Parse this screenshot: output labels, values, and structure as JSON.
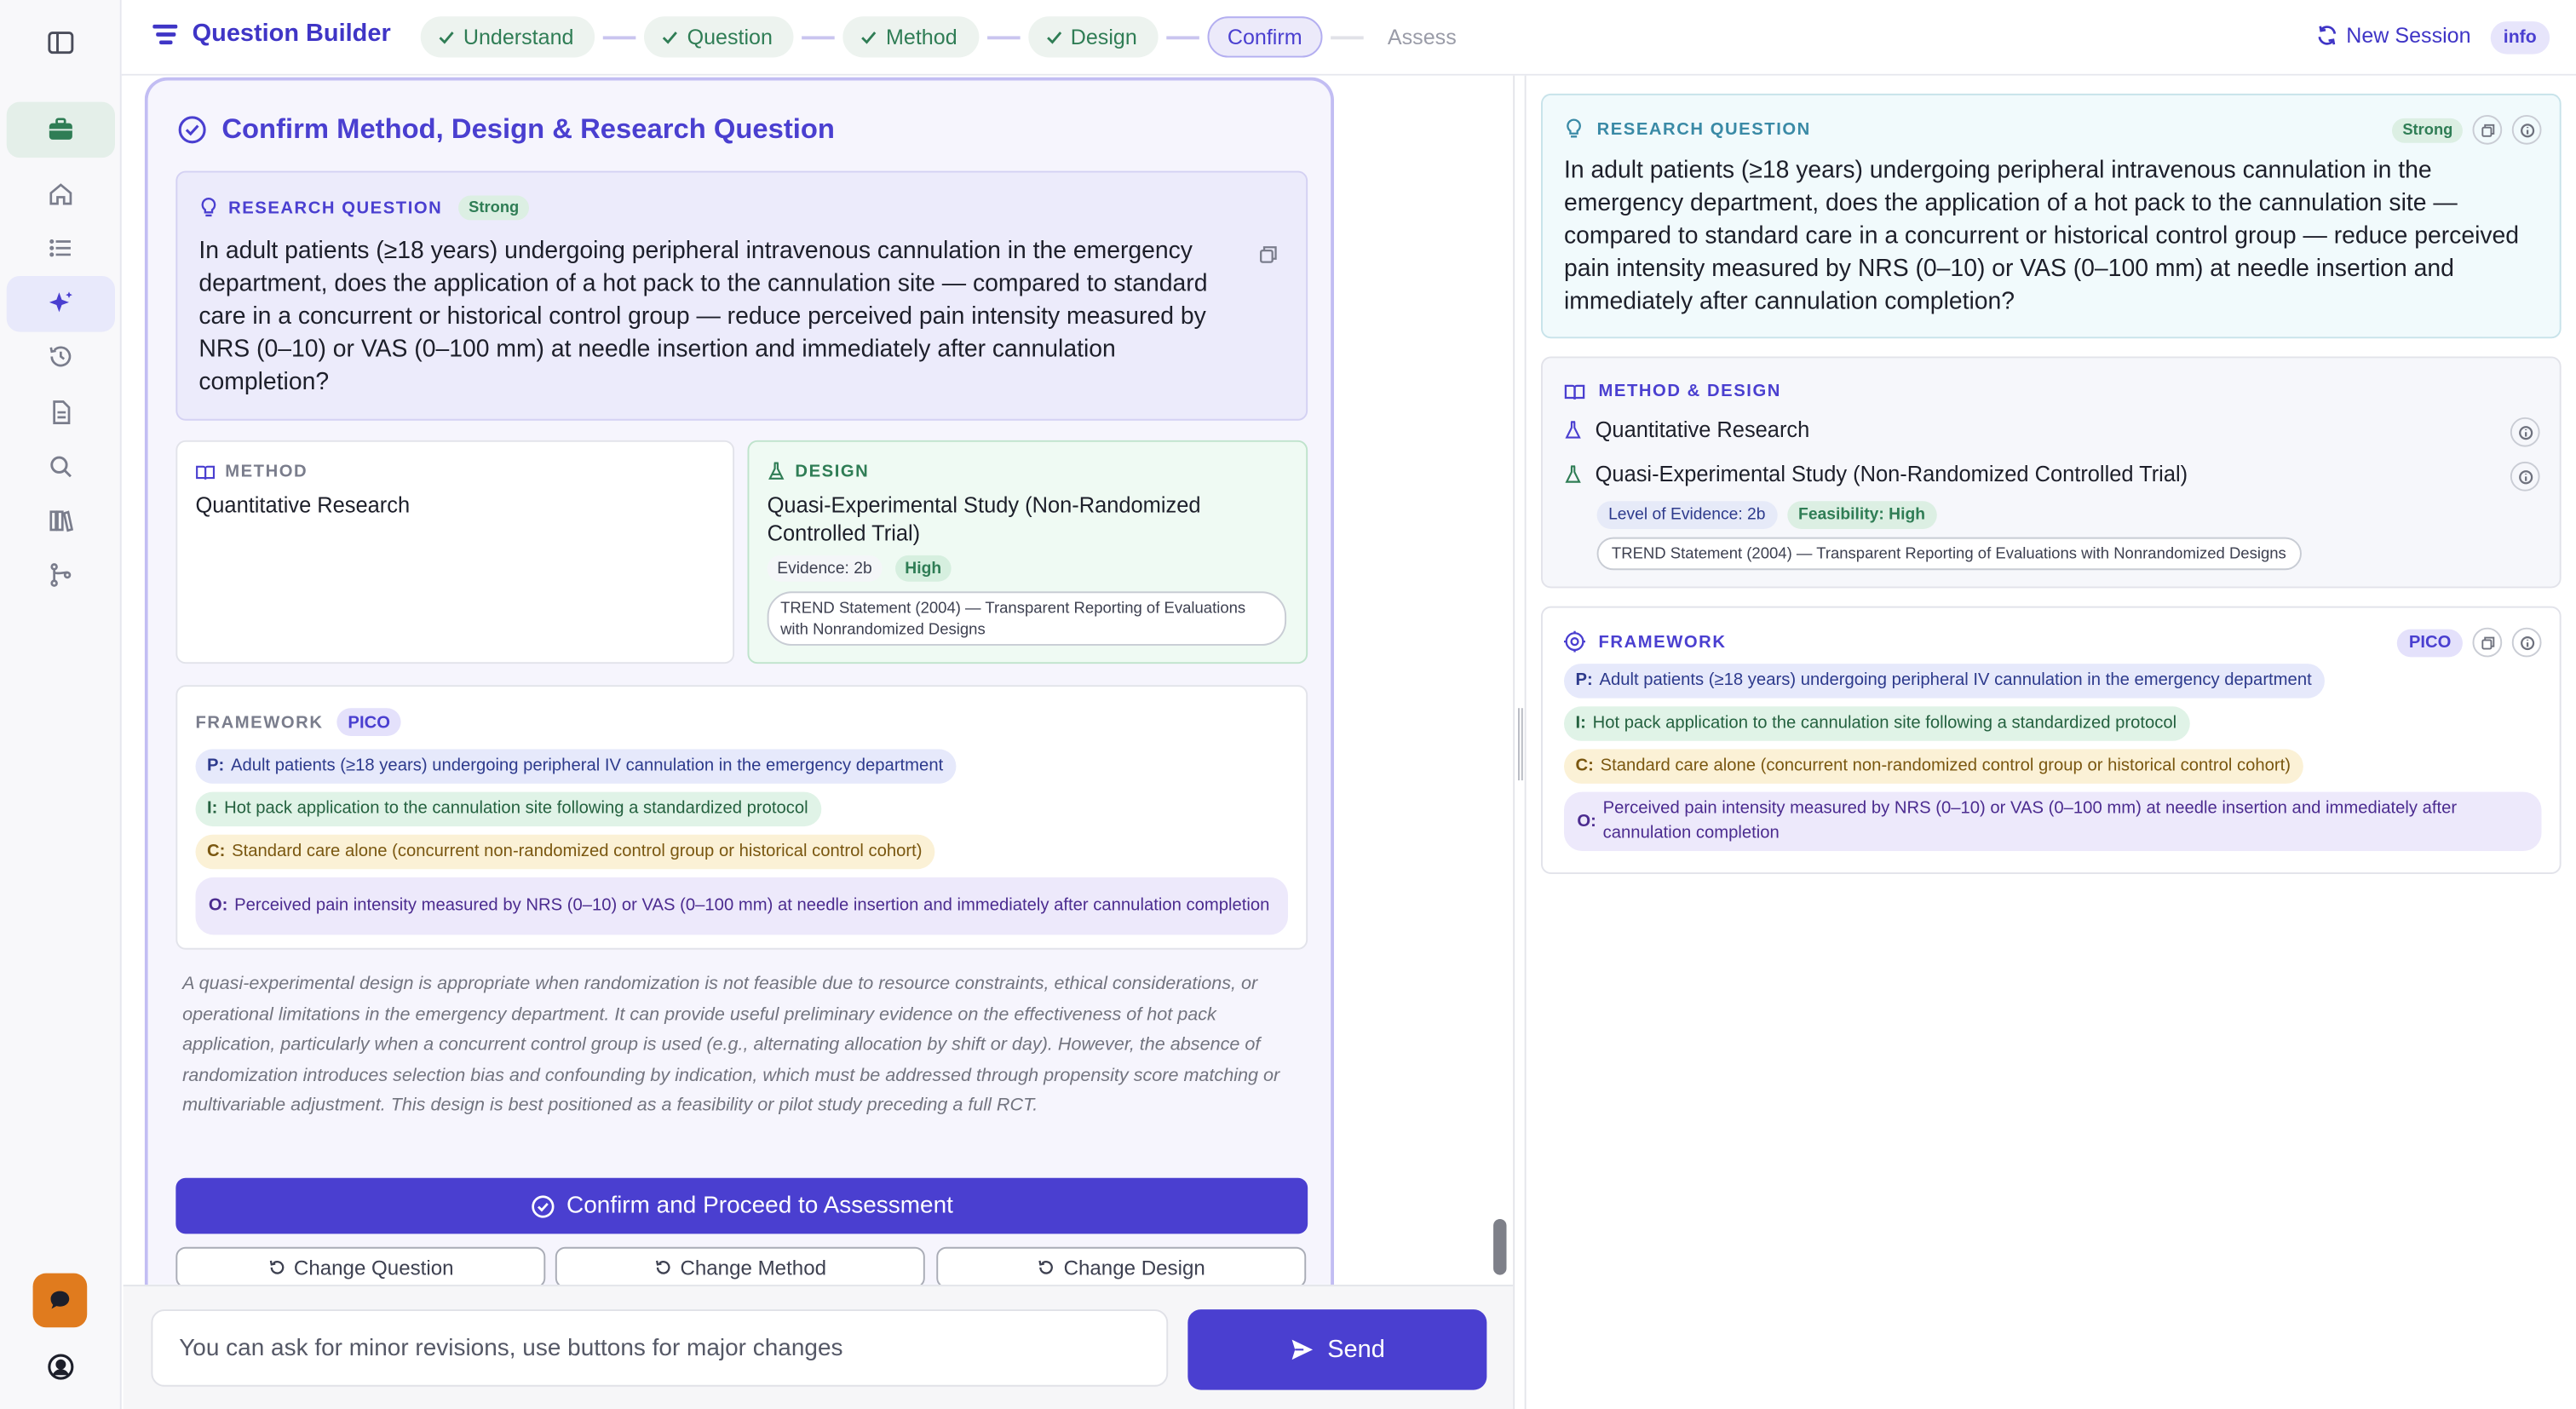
{
  "app": {
    "title": "Question Builder",
    "new_session": "New Session",
    "info_badge": "info",
    "steps": [
      {
        "label": "Understand",
        "state": "done"
      },
      {
        "label": "Question",
        "state": "done"
      },
      {
        "label": "Method",
        "state": "done"
      },
      {
        "label": "Design",
        "state": "done"
      },
      {
        "label": "Confirm",
        "state": "current"
      },
      {
        "label": "Assess",
        "state": "pending"
      }
    ]
  },
  "sidebar": {
    "icons": [
      "panel-toggle-icon",
      "briefcase-icon",
      "home-icon",
      "list-icon",
      "sparkles-icon",
      "history-icon",
      "document-icon",
      "search-icon",
      "library-icon",
      "branch-icon"
    ],
    "active": "sparkles-icon"
  },
  "confirm": {
    "title": "Confirm Method, Design & Research Question",
    "rq_label": "Research Question",
    "rq_strength": "Strong",
    "rq_text": "In adult patients (≥18 years) undergoing peripheral intravenous cannulation in the emergency department, does the application of a hot pack to the cannulation site — compared to standard care in a concurrent or historical control group — reduce perceived pain intensity measured by NRS (0–10) or VAS (0–100 mm) at needle insertion and immediately after cannulation completion?",
    "method_label": "Method",
    "method_value": "Quantitative Research",
    "design_label": "Design",
    "design_value": "Quasi-Experimental Study (Non-Randomized Controlled Trial)",
    "evidence": "Evidence: 2b",
    "feasibility": "High",
    "guideline": "TREND Statement (2004) — Transparent Reporting of Evaluations with Nonrandomized Designs",
    "framework_label": "Framework",
    "framework_type": "PICO",
    "pico": [
      {
        "key": "P:",
        "text": "Adult patients (≥18 years) undergoing peripheral IV cannulation in the emergency department"
      },
      {
        "key": "I:",
        "text": "Hot pack application to the cannulation site following a standardized protocol"
      },
      {
        "key": "C:",
        "text": "Standard care alone (concurrent non-randomized control group or historical control cohort)"
      },
      {
        "key": "O:",
        "text": "Perceived pain intensity measured by NRS (0–10) or VAS (0–100 mm) at needle insertion and immediately after cannulation completion"
      }
    ],
    "rationale": "A quasi-experimental design is appropriate when randomization is not feasible due to resource constraints, ethical considerations, or operational limitations in the emergency department. It can provide useful preliminary evidence on the effectiveness of hot pack application, particularly when a concurrent control group is used (e.g., alternating allocation by shift or day). However, the absence of randomization introduces selection bias and confounding by indication, which must be addressed through propensity score matching or multivariable adjustment. This design is best positioned as a feasibility or pilot study preceding a full RCT.",
    "confirm_button": "Confirm and Proceed to Assessment",
    "change_question": "Change Question",
    "change_method": "Change Method",
    "change_design": "Change Design"
  },
  "composer": {
    "placeholder": "You can ask for minor revisions, use buttons for major changes",
    "send": "Send"
  },
  "summary": {
    "rq_label": "Research Question",
    "rq_strength": "Strong",
    "rq_text": "In adult patients (≥18 years) undergoing peripheral intravenous cannulation in the emergency department, does the application of a hot pack to the cannulation site — compared to standard care in a concurrent or historical control group — reduce perceived pain intensity measured by NRS (0–10) or VAS (0–100 mm) at needle insertion and immediately after cannulation completion?",
    "md_label": "Method & Design",
    "method": "Quantitative Research",
    "design": "Quasi-Experimental Study (Non-Randomized Controlled Trial)",
    "level_of_evidence": "Level of Evidence: 2b",
    "feasibility": "Feasibility: High",
    "guideline": "TREND Statement (2004) — Transparent Reporting of Evaluations with Nonrandomized Designs",
    "framework_label": "Framework",
    "framework_type": "PICO",
    "pico": [
      {
        "key": "P:",
        "text": "Adult patients (≥18 years) undergoing peripheral IV cannulation in the emergency department"
      },
      {
        "key": "I:",
        "text": "Hot pack application to the cannulation site following a standardized protocol"
      },
      {
        "key": "C:",
        "text": "Standard care alone (concurrent non-randomized control group or historical control cohort)"
      },
      {
        "key": "O:",
        "text": "Perceived pain intensity measured by NRS (0–10) or VAS (0–100 mm) at needle insertion and immediately after cannulation completion"
      }
    ]
  },
  "colors": {
    "accent": "#4a3fd0",
    "success": "#2f7d55",
    "chat_button": "#e07b1e"
  }
}
